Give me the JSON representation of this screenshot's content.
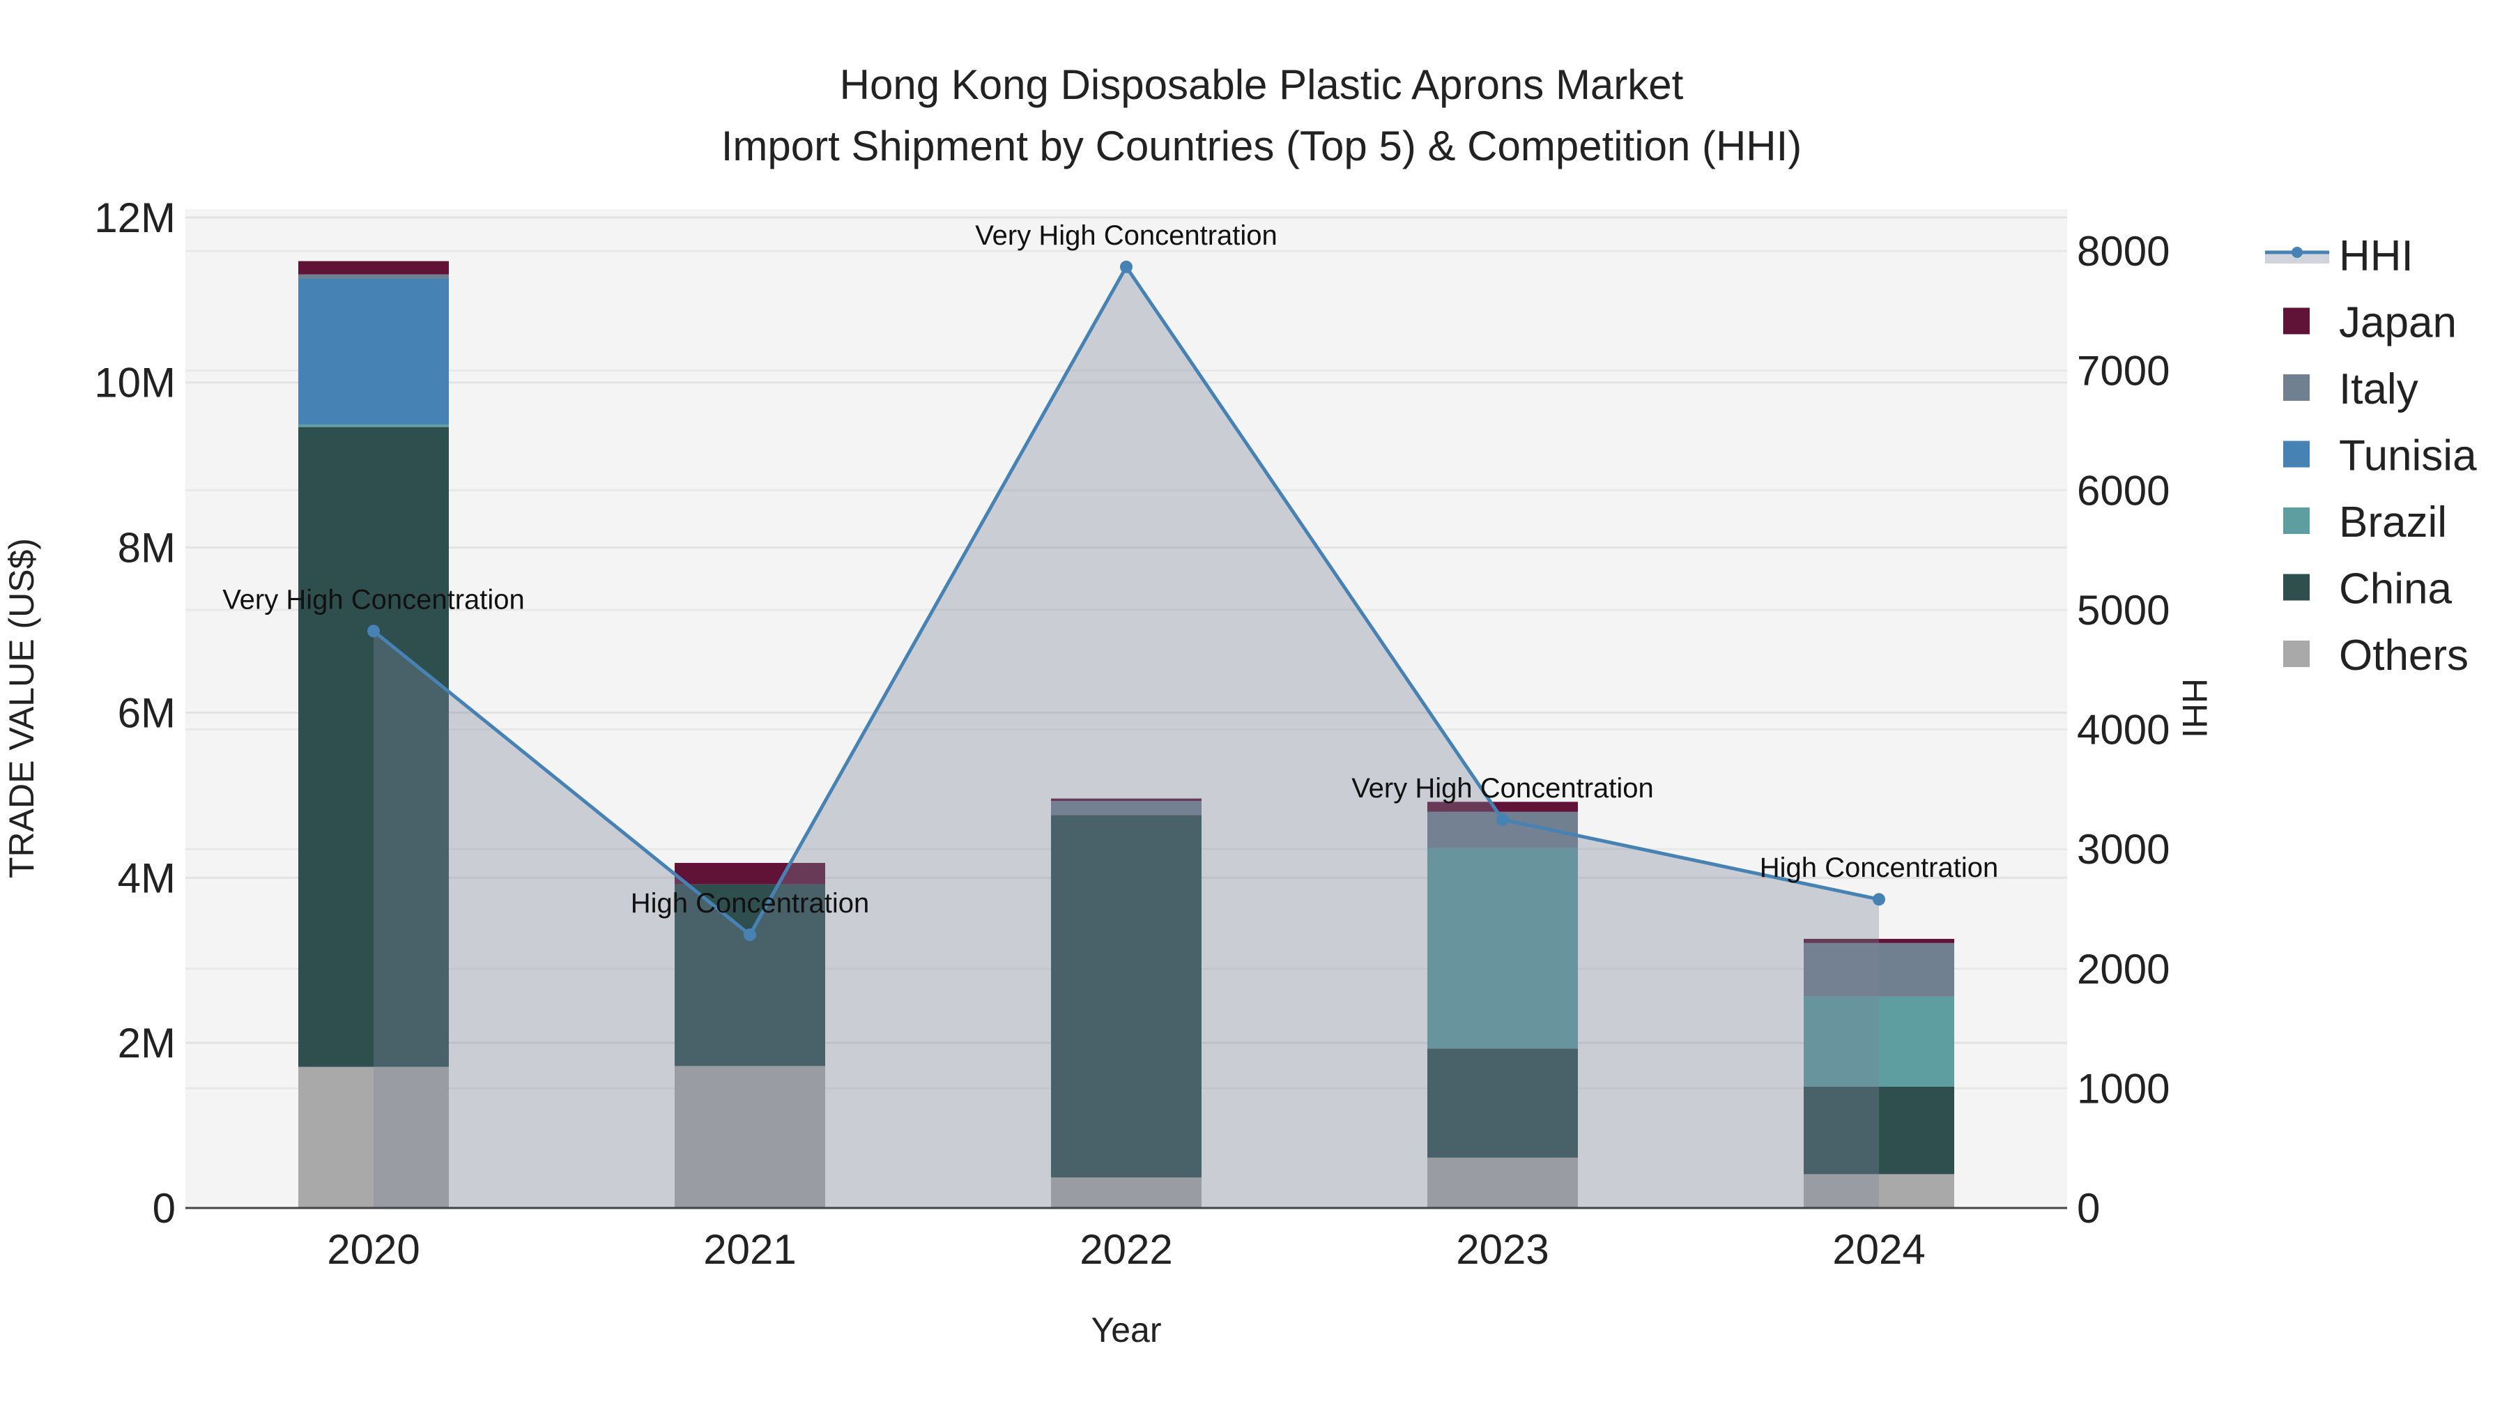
{
  "chart_data": {
    "type": "bar",
    "stacked": true,
    "title_line1": "Hong Kong Disposable Plastic Aprons Market",
    "title_line2": "Import Shipment by Countries (Top 5) & Competition (HHI)",
    "xlabel": "Year",
    "ylabel": "TRADE VALUE (US$)",
    "y2label": "HHI",
    "categories": [
      "2020",
      "2021",
      "2022",
      "2023",
      "2024"
    ],
    "ylim": [
      0,
      12100000
    ],
    "y2lim": [
      0,
      8350
    ],
    "yticks": [
      0,
      2000000,
      4000000,
      6000000,
      8000000,
      10000000,
      12000000
    ],
    "ytick_labels": [
      "0",
      "2M",
      "4M",
      "6M",
      "8M",
      "10M",
      "12M"
    ],
    "y2ticks": [
      0,
      1000,
      2000,
      3000,
      4000,
      5000,
      6000,
      7000,
      8000
    ],
    "y2tick_labels": [
      "0",
      "1000",
      "2000",
      "3000",
      "4000",
      "5000",
      "6000",
      "7000",
      "8000"
    ],
    "grid": true,
    "legend_position": "right",
    "series": [
      {
        "name": "Others",
        "color": "#a9a9a9",
        "values": [
          1710000,
          1720000,
          370000,
          610000,
          410000
        ]
      },
      {
        "name": "China",
        "color": "#2f4f4f",
        "values": [
          7750000,
          2200000,
          4390000,
          1320000,
          1060000
        ]
      },
      {
        "name": "Brazil",
        "color": "#5f9ea0",
        "values": [
          30000,
          0,
          0,
          2430000,
          1090000
        ]
      },
      {
        "name": "Tunisia",
        "color": "#4682b4",
        "values": [
          1770000,
          0,
          0,
          0,
          0
        ]
      },
      {
        "name": "Italy",
        "color": "#708090",
        "values": [
          50000,
          0,
          170000,
          440000,
          650000
        ]
      },
      {
        "name": "Japan",
        "color": "#601336",
        "values": [
          160000,
          260000,
          30000,
          120000,
          50000
        ]
      }
    ],
    "hhi": {
      "name": "HHI",
      "type": "line",
      "axis": "right",
      "color": "#4682b4",
      "values": [
        4823,
        2284,
        7867,
        3246,
        2580
      ],
      "annotations": [
        "Very High Concentration",
        "High Concentration",
        "Very High Concentration",
        "Very High Concentration",
        "High Concentration"
      ]
    },
    "legend": [
      "HHI",
      "Japan",
      "Italy",
      "Tunisia",
      "Brazil",
      "China",
      "Others"
    ]
  }
}
